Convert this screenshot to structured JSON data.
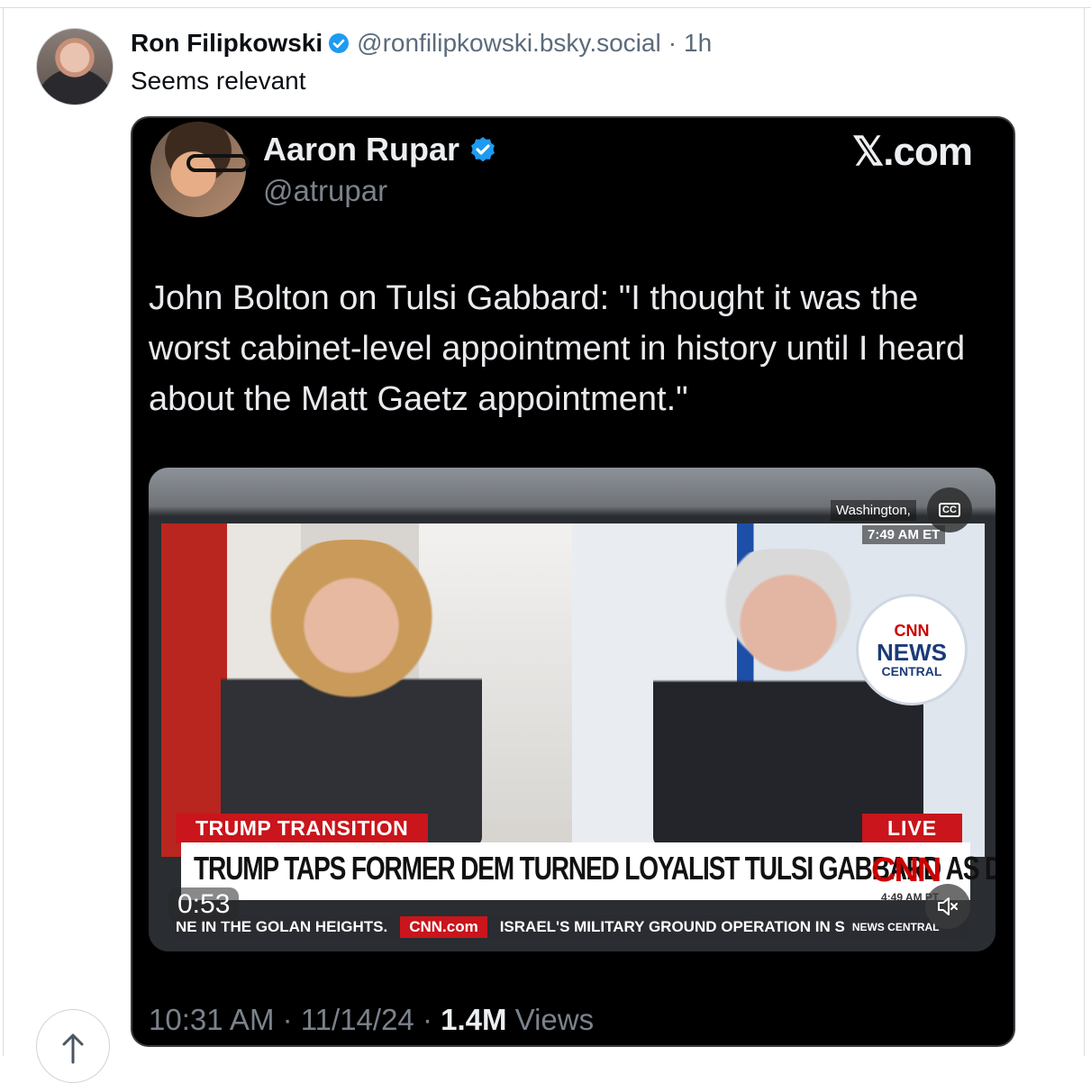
{
  "post": {
    "author_name": "Ron Filipkowski",
    "handle": "@ronfilipkowski.bsky.social",
    "separator": "·",
    "time_ago": "1h",
    "text": "Seems relevant"
  },
  "embed": {
    "author_name": "Aaron Rupar",
    "handle": "@atrupar",
    "source": "𝕏.com",
    "text": "John Bolton on Tulsi Gabbard: \"I thought it was the worst cabinet-level appointment in history until I heard about the Matt Gaetz appointment.\"",
    "video": {
      "location": "Washington,",
      "clock": "7:49 AM ET",
      "tag_left": "TRUMP TRANSITION",
      "tag_live": "LIVE",
      "headline": "TRUMP TAPS FORMER DEM TURNED LOYALIST TULSI GABBARD AS DNI",
      "network": "CNN",
      "network_time": "4:49 AM PT",
      "cnn_logo": [
        "CNN",
        "NEWS",
        "CENTRAL"
      ],
      "ticker_left": "NE IN THE GOLAN HEIGHTS.",
      "ticker_site": "CNN.com",
      "ticker_right": "ISRAEL'S MILITARY GROUND OPERATION IN S",
      "ticker_brand": "NEWS CENTRAL",
      "duration": "0:53",
      "cc_label": "CC"
    },
    "footer": {
      "time": "10:31 AM",
      "date": "11/14/24",
      "views_count": "1.4M",
      "views_label": "Views",
      "sep": "·"
    }
  },
  "icons": {
    "verified": "verified-badge-icon",
    "scroll_top": "arrow-up-icon",
    "mute": "muted-speaker-icon",
    "cc": "closed-captions-icon"
  },
  "colors": {
    "verified_blue": "#1d9bf0",
    "cnn_red": "#cc0000"
  }
}
